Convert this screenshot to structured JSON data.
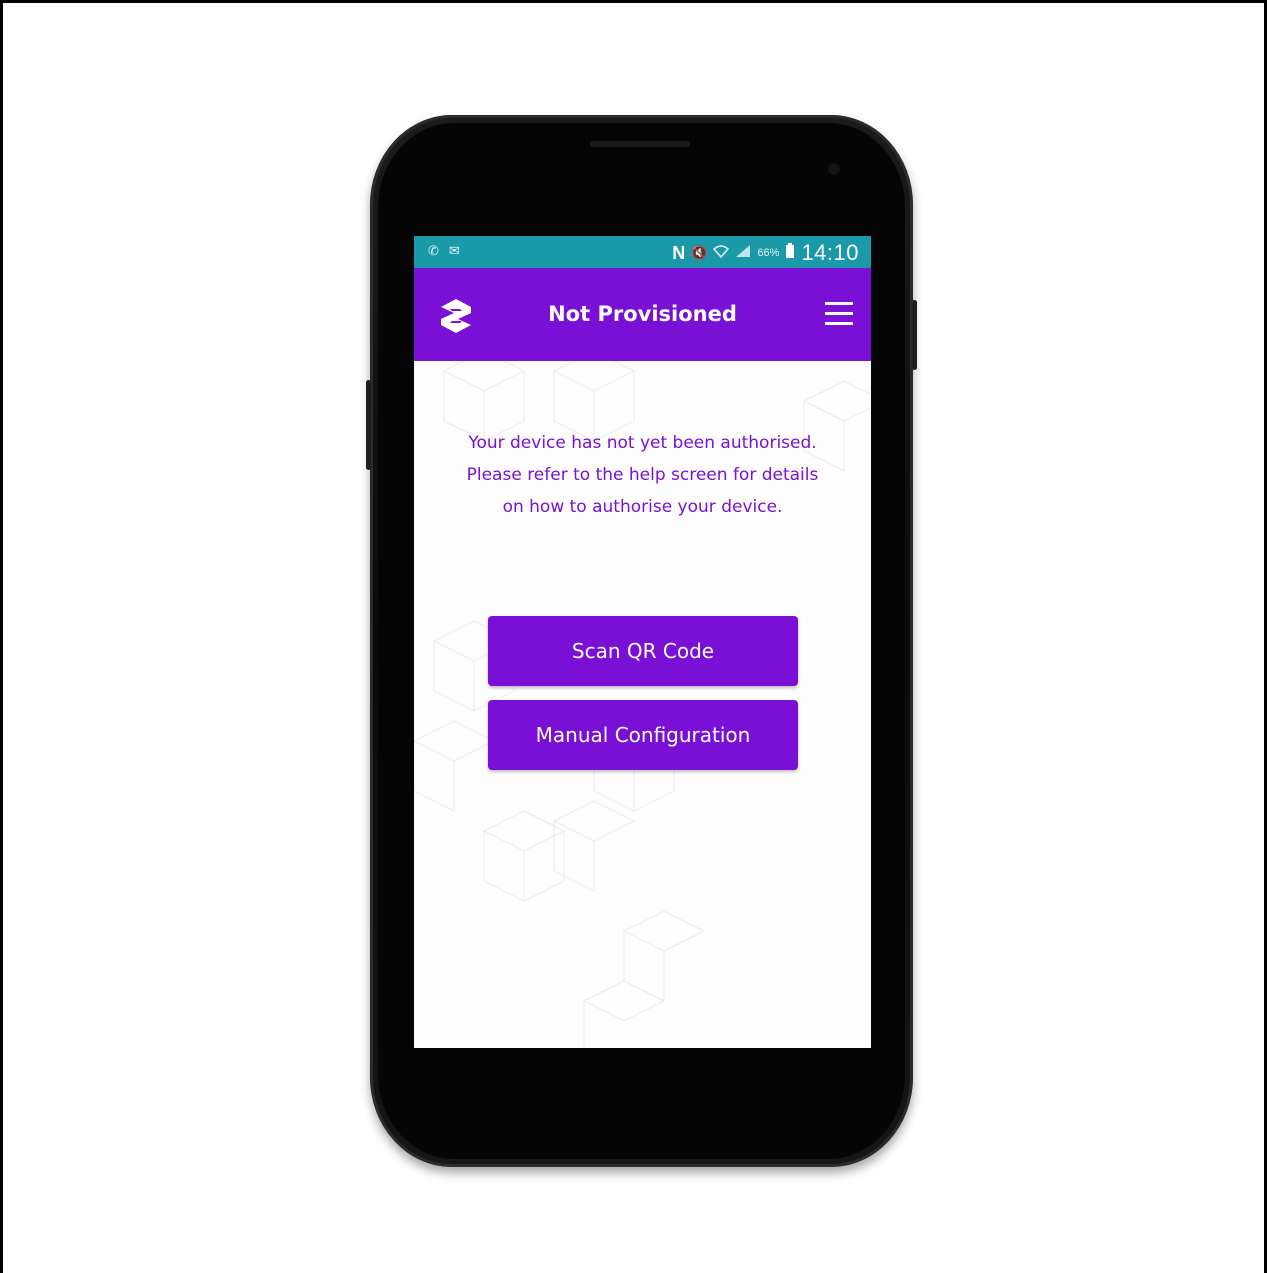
{
  "status_bar": {
    "left_icons": [
      "phone-call-icon",
      "message-icon"
    ],
    "nfc_label": "N",
    "right_icons": [
      "mute-icon",
      "wifi-icon",
      "signal-icon"
    ],
    "battery_percent": "66%",
    "time": "14:10"
  },
  "app_bar": {
    "logo_icon": "app-logo-icon",
    "title": "Not Provisioned",
    "menu_icon": "hamburger-menu-icon"
  },
  "main": {
    "message": "Your device has not yet been authorised. Please refer to the help screen for details on how to authorise your device.",
    "scan_button_label": "Scan QR Code",
    "manual_button_label": "Manual Configuration"
  },
  "colors": {
    "status_bar": "#1a9aa9",
    "primary": "#7a0fd6",
    "message_text": "#7a12cf",
    "phone_body": "#0a0a0a"
  }
}
